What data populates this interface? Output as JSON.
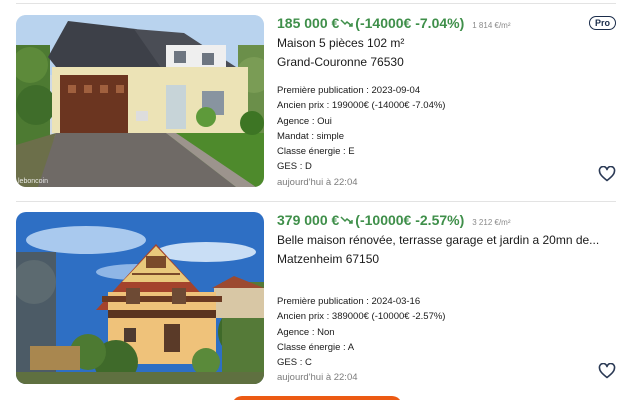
{
  "listings": [
    {
      "price": "185 000 €",
      "trend_icon": "trend-down-icon",
      "price_change": "(-14000€ -7.04%)",
      "price_per_m2": "1 814 €/m²",
      "badge": "Pro",
      "title": "Maison 5 pièces 102 m²",
      "location": "Grand-Couronne 76530",
      "details": [
        "Première publication : 2023-09-04",
        "Ancien prix : 199000€ (-14000€ -7.04%)",
        "Agence : Oui",
        "Mandat : simple",
        "Classe énergie : E",
        "GES : D"
      ],
      "date": "aujourd'hui à 22:04",
      "watermark": "leboncoin",
      "favorite_icon": "heart-outline-icon"
    },
    {
      "price": "379 000 €",
      "trend_icon": "trend-down-icon",
      "price_change": "(-10000€ -2.57%)",
      "price_per_m2": "3 212 €/m²",
      "title": "Belle maison rénovée, terrasse garage et jardin a 20mn de...",
      "location": "Matzenheim 67150",
      "details": [
        "Première publication : 2024-03-16",
        "Ancien prix : 389000€ (-10000€ -2.57%)",
        "Agence : Non",
        "Classe énergie : A",
        "GES : C"
      ],
      "date": "aujourd'hui à 22:04",
      "favorite_icon": "heart-outline-icon"
    }
  ],
  "colors": {
    "price_green": "#3f8f4a",
    "accent_orange": "#ec5a13",
    "pro_badge": "#1a2c4a"
  }
}
